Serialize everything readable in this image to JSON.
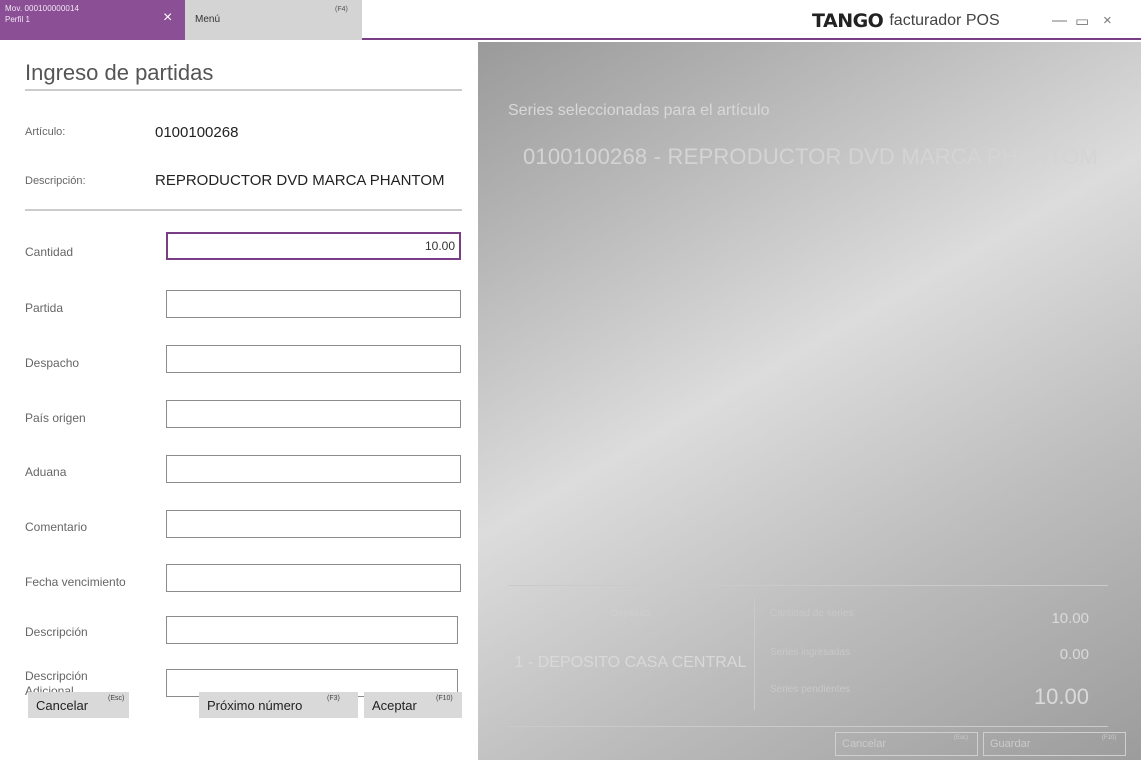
{
  "tabs": {
    "active": {
      "line1": "Mov. 000100000014",
      "line2": "Perfil 1",
      "close_glyph": "×"
    },
    "menu": {
      "label": "Menú",
      "shortcut": "(F4)"
    }
  },
  "brand": {
    "logo_text": "TANGO",
    "app_name": "facturador POS"
  },
  "window_controls": {
    "minimize": "—",
    "maximize": "▭",
    "close": "×"
  },
  "form": {
    "title": "Ingreso de partidas",
    "articulo_label": "Artículo:",
    "articulo_value": "0100100268",
    "descripcion_label": "Descripción:",
    "descripcion_value": "REPRODUCTOR DVD MARCA PHANTOM",
    "fields": [
      {
        "label": "Cantidad",
        "value": "10.00"
      },
      {
        "label": "Partida",
        "value": ""
      },
      {
        "label": "Despacho",
        "value": ""
      },
      {
        "label": "País origen",
        "value": ""
      },
      {
        "label": "Aduana",
        "value": ""
      },
      {
        "label": "Comentario",
        "value": ""
      },
      {
        "label": "Fecha vencimiento",
        "value": ""
      },
      {
        "label": "Descripción",
        "value": ""
      },
      {
        "label": "Descripción Adicional",
        "value": ""
      }
    ],
    "buttons": {
      "cancel": {
        "label": "Cancelar",
        "key": "(Esc)"
      },
      "next": {
        "label": "Próximo número",
        "key": "(F3)"
      },
      "accept": {
        "label": "Aceptar",
        "key": "(F10)"
      }
    }
  },
  "series_panel": {
    "heading": "Series seleccionadas para el artículo",
    "article": "0100100268  -  REPRODUCTOR DVD MARCA PHANTOM",
    "deposito_label": "Depósito",
    "deposito_value": "1 - DEPOSITO CASA CENTRAL",
    "stats": [
      {
        "label": "Cantidad de series",
        "value": "10.00"
      },
      {
        "label": "Series ingresadas",
        "value": "0.00"
      },
      {
        "label": "Series pendientes",
        "value": "10.00"
      }
    ],
    "buttons": {
      "cancel": {
        "label": "Cancelar",
        "key": "(Esc)"
      },
      "save": {
        "label": "Guardar",
        "key": "(F10)"
      }
    }
  },
  "colors": {
    "accent": "#7a3e86",
    "tab_active": "#8a4f95",
    "tab_inactive": "#d4d4d4"
  },
  "icons": {
    "close_tab": "close-icon",
    "minimize": "minimize-icon",
    "maximize": "maximize-icon",
    "close_window": "close-window-icon"
  }
}
